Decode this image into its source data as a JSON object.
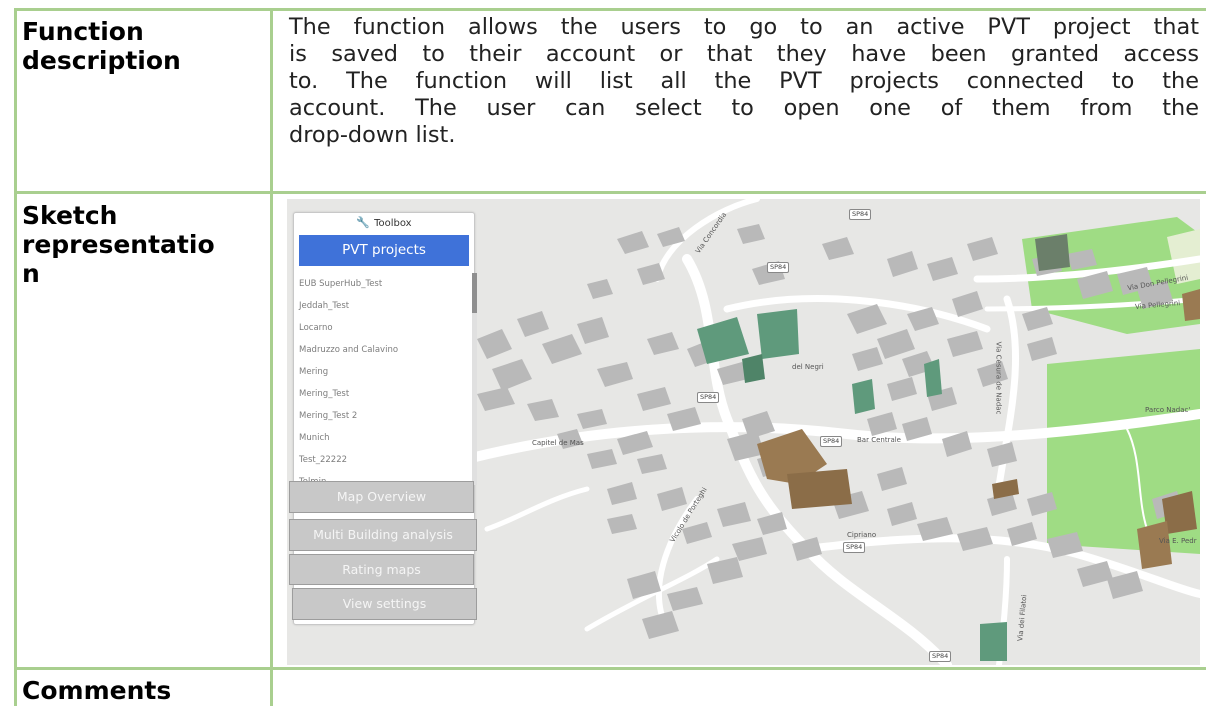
{
  "rows": {
    "function": {
      "label_line1": "Function",
      "label_line2": "description",
      "description_lines": [
        "The function allows the users to go to an active PVT project that",
        "is saved to their account or that they have been granted access",
        "to. The function will list all the PVT projects connected to the",
        "account. The user can select to open one of them from the",
        "drop-down list."
      ]
    },
    "sketch": {
      "label_line1": "Sketch",
      "label_line2": "representatio",
      "label_line3": "n"
    },
    "comments": {
      "label": "Comments"
    }
  },
  "toolbox": {
    "title": "Toolbox",
    "title_icon": "wrench-icon",
    "pvt_button": "PVT projects",
    "projects": [
      "EUB SuperHub_Test",
      "Jeddah_Test",
      "Locarno",
      "Madruzzo and Calavino",
      "Mering",
      "Mering_Test",
      "Mering_Test 2",
      "Munich",
      "Test_22222",
      "Tolmin"
    ],
    "buttons": {
      "map_overview": "Map Overview",
      "multi_building": "Multi  Building analysis",
      "rating_maps": "Rating maps",
      "view_settings": "View settings"
    }
  },
  "map_labels": {
    "via_concordia": "Via Concordia",
    "via_don_pellegrini": "Via Don Pellegrini",
    "via_pellegrini": "Via Pellegrini",
    "via_cesura_de_nadac": "Via Cesura de Nadac",
    "parco_nadac": "Parco Nadac'",
    "capitel_de_mas": "Capitel de Mas",
    "bar_centrale": "Bar Centrale",
    "del_negri": "del Negri",
    "vicolo_de_porteghi": "Vicolo de Porteghi",
    "cipriano": "Cipriano",
    "via_e_pedrotti": "Via E. Pedr",
    "via_dei_filatoi": "Via dei Filatoi",
    "road_shield": "SP84"
  },
  "colors": {
    "table_border": "#a9cf8f",
    "pvt_button": "#3f72d9",
    "map_background": "#e7e7e5",
    "building_gray": "#b9b9b9",
    "building_green": "#5f9a7c",
    "building_brown": "#9a7a52",
    "park_green": "#9fdc84"
  }
}
